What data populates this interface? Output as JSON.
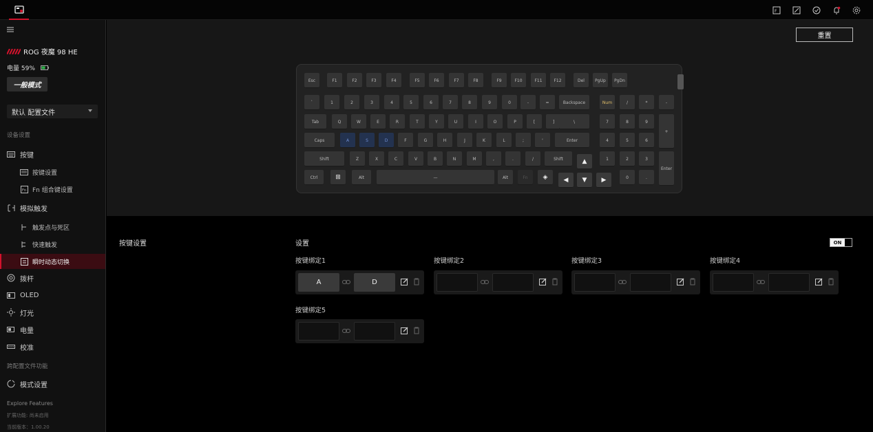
{
  "topbar": {
    "icons": [
      "keyboard-device-icon",
      "edit-icon",
      "screen-icon",
      "sync-icon",
      "notification-icon",
      "settings-icon"
    ]
  },
  "sidebar": {
    "device_name": "ROG 夜魔 98 HE",
    "battery": "电量 59%",
    "mode": "一般模式",
    "profile": "默认 配置文件",
    "section_device": "设备设置",
    "items": [
      {
        "label": "按键",
        "icon": "keyboard-icon"
      },
      {
        "label": "按键设置",
        "icon": "keyboard-settings-icon"
      },
      {
        "label": "Fn 组合键设置",
        "icon": "fn-icon"
      },
      {
        "label": "模拟触发",
        "icon": "analog-trigger-icon"
      },
      {
        "label": "触发点与死区",
        "icon": "trigger-point-icon"
      },
      {
        "label": "快速触发",
        "icon": "rapid-trigger-icon"
      },
      {
        "label": "瞬时动态切换",
        "icon": "dynamic-switch-icon"
      },
      {
        "label": "拨杆",
        "icon": "dial-icon"
      },
      {
        "label": "OLED",
        "icon": "oled-icon"
      },
      {
        "label": "灯光",
        "icon": "lighting-icon"
      },
      {
        "label": "电量",
        "icon": "battery-icon"
      },
      {
        "label": "校准",
        "icon": "calibration-icon"
      }
    ],
    "section_cross": "跨配置文件功能",
    "mode_settings": "模式设置",
    "explore": "Explore Features",
    "ext": "扩展功能: 尚未启用",
    "version": "当前版本：1.00.20"
  },
  "reset_label": "重置",
  "keyboard": {
    "rows": [
      [
        "Esc",
        "F1",
        "F2",
        "F3",
        "F4",
        "F5",
        "F6",
        "F7",
        "F8",
        "F9",
        "F10",
        "F11",
        "F12",
        "Del",
        "PgUp",
        "PgDn"
      ],
      [
        "`",
        "1",
        "2",
        "3",
        "4",
        "5",
        "6",
        "7",
        "8",
        "9",
        "0",
        "-",
        "=",
        "Backspace",
        "Num",
        "/",
        "*",
        "-"
      ],
      [
        "Tab",
        "Q",
        "W",
        "E",
        "R",
        "T",
        "Y",
        "U",
        "I",
        "O",
        "P",
        "[",
        "]",
        "\\",
        "7",
        "8",
        "9",
        "+"
      ],
      [
        "Caps",
        "A",
        "S",
        "D",
        "F",
        "G",
        "H",
        "J",
        "K",
        "L",
        ";",
        "'",
        "Enter",
        "4",
        "5",
        "6"
      ],
      [
        "Shift",
        "Z",
        "X",
        "C",
        "V",
        "B",
        "N",
        "M",
        ",",
        ".",
        "/",
        "Shift",
        "▲",
        "1",
        "2",
        "3",
        "Enter"
      ],
      [
        "Ctrl",
        "⊞",
        "Alt",
        "—",
        "Alt",
        "Fn",
        "◈",
        "◀",
        "▼",
        "▶",
        "0",
        "."
      ]
    ]
  },
  "settings": {
    "section_title": "按键设置",
    "setting_label": "设置",
    "toggle": "ON",
    "bindings": [
      {
        "label": "按键绑定1",
        "key1": "A",
        "key2": "D"
      },
      {
        "label": "按键绑定2",
        "key1": "",
        "key2": ""
      },
      {
        "label": "按键绑定3",
        "key1": "",
        "key2": ""
      },
      {
        "label": "按键绑定4",
        "key1": "",
        "key2": ""
      },
      {
        "label": "按键绑定5",
        "key1": "",
        "key2": ""
      }
    ]
  },
  "colors": {
    "accent": "#d3122c",
    "highlight": "#23324f"
  }
}
